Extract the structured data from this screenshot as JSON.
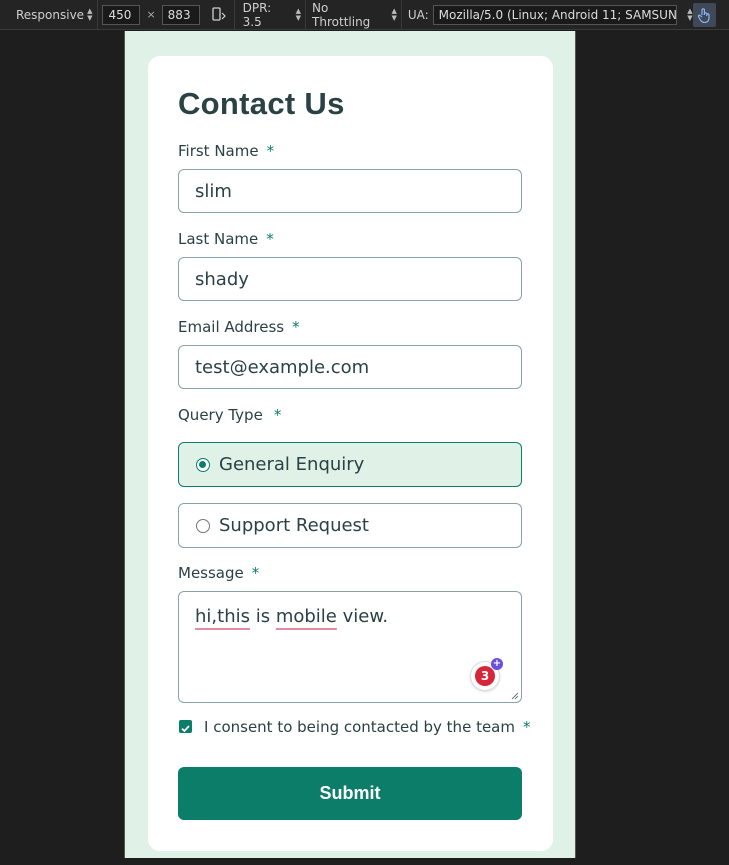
{
  "devtools": {
    "device_mode": "Responsive",
    "width": "450",
    "height": "883",
    "dpr": "DPR: 3.5",
    "throttling": "No Throttling",
    "ua_label": "UA:",
    "ua_value": "Mozilla/5.0 (Linux; Android 11; SAMSUNG SM",
    "times": "×"
  },
  "form": {
    "title": "Contact Us",
    "required_mark": "*",
    "first_name": {
      "label": "First Name",
      "value": "slim"
    },
    "last_name": {
      "label": "Last Name",
      "value": "shady"
    },
    "email": {
      "label": "Email Address",
      "value": "test@example.com"
    },
    "query_type": {
      "label": "Query Type",
      "options": [
        {
          "label": "General Enquiry",
          "selected": true
        },
        {
          "label": "Support Request",
          "selected": false
        }
      ]
    },
    "message": {
      "label": "Message",
      "value_parts": [
        "hi,this",
        " is ",
        "mobile",
        " view."
      ]
    },
    "extension_badge_count": "3",
    "consent": {
      "label": "I consent to being contacted by the team",
      "checked": true
    },
    "submit_label": "Submit"
  },
  "colors": {
    "accent": "#0c7d69",
    "page_background": "#e0f1e8",
    "text": "#2a4244"
  }
}
